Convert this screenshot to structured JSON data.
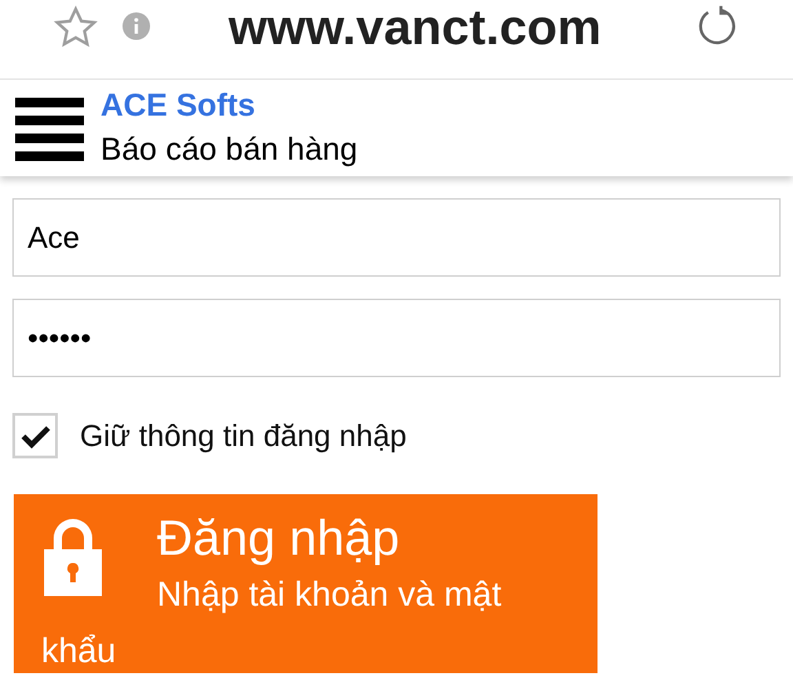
{
  "browser_bar": {
    "url": "www.vanct.com"
  },
  "header": {
    "title": "ACE Softs",
    "subtitle": "Báo cáo bán hàng"
  },
  "form": {
    "username": {
      "value": "Ace"
    },
    "password": {
      "value": "••••••"
    },
    "remember": {
      "label": "Giữ thông tin đăng nhập",
      "checked": true
    },
    "login_button": {
      "title": "Đăng nhập",
      "subtitle": "Nhập tài khoản và mật khẩu"
    }
  }
}
